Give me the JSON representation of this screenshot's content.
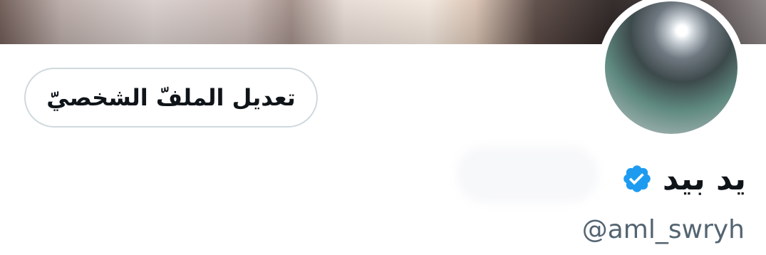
{
  "profile": {
    "edit_button_label": "تعديل الملفّ الشخصيّ",
    "display_name": "يد بيد",
    "handle": "@aml_swryh",
    "verified": true
  },
  "colors": {
    "text_primary": "#0f1419",
    "text_secondary": "#536471",
    "button_border": "#cfd9de",
    "verified_badge": "#1d9bf0"
  },
  "icons": {
    "verified": "verified-badge-icon"
  }
}
